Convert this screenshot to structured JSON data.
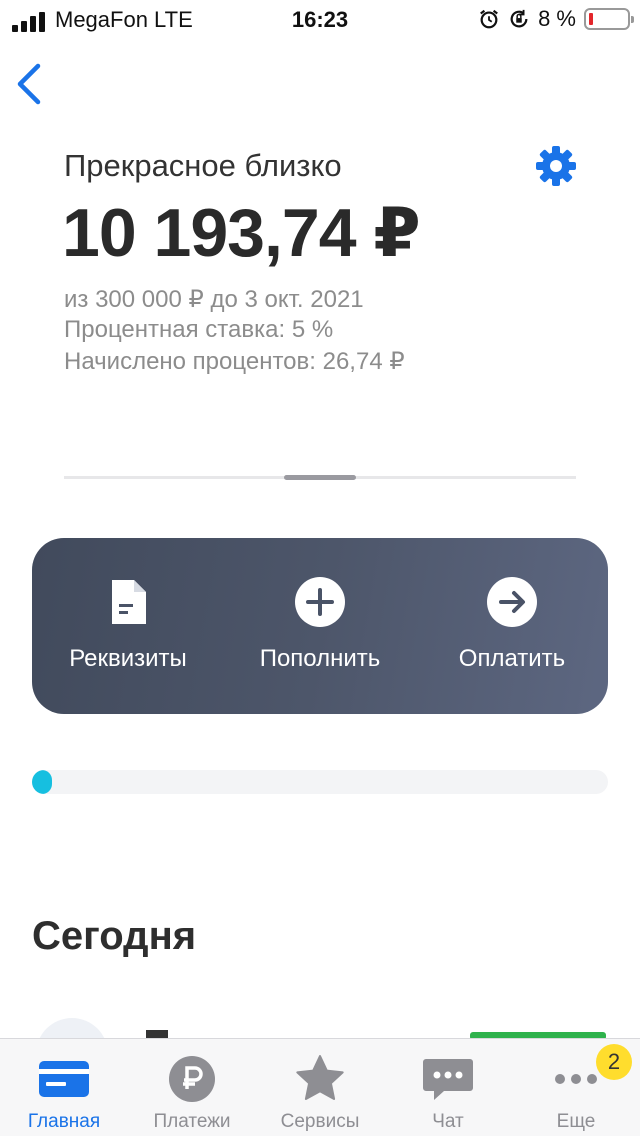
{
  "status_bar": {
    "carrier": "MegaFon LTE",
    "time": "16:23",
    "battery": "8 %",
    "battery_level": 0.08
  },
  "header": {
    "back_icon": "chevron-left-icon",
    "settings_icon": "gear-icon"
  },
  "account": {
    "name": "Прекрасное близко",
    "balance": "10 193,74 ₽",
    "goal_line": "из 300 000 ₽ до 3 окт. 2021",
    "rate_line": "Процентная ставка: 5 %",
    "interest_line": "Начислено процентов: 26,74 ₽"
  },
  "actions": [
    {
      "label": "Реквизиты",
      "icon": "document-icon"
    },
    {
      "label": "Пополнить",
      "icon": "plus-circle-icon"
    },
    {
      "label": "Оплатить",
      "icon": "arrow-right-circle-icon"
    }
  ],
  "progress": {
    "value": 0.034,
    "color": "#16bfe0"
  },
  "feed": {
    "section_title": "Сегодня"
  },
  "tabs": [
    {
      "label": "Главная",
      "icon": "card-icon",
      "active": true
    },
    {
      "label": "Платежи",
      "icon": "ruble-icon",
      "active": false
    },
    {
      "label": "Сервисы",
      "icon": "star-icon",
      "active": false
    },
    {
      "label": "Чат",
      "icon": "chat-icon",
      "active": false
    },
    {
      "label": "Еще",
      "icon": "more-icon",
      "active": false,
      "badge": "2"
    }
  ],
  "colors": {
    "accent": "#1a73e8",
    "badge": "#ffdd2d",
    "card_bg": "#4d566a"
  }
}
